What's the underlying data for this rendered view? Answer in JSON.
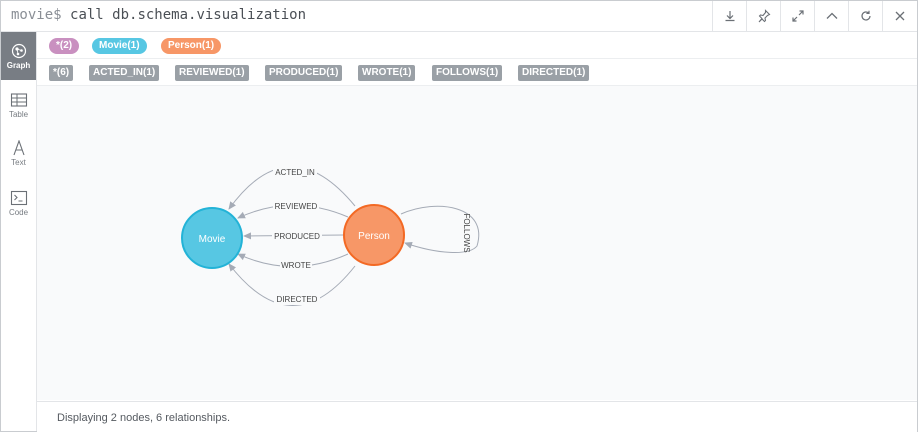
{
  "command": {
    "prompt": "movie$",
    "query": "call db.schema.visualization"
  },
  "toolbar": {
    "buttons": [
      {
        "name": "download-icon"
      },
      {
        "name": "pin-icon"
      },
      {
        "name": "expand-icon"
      },
      {
        "name": "collapse-up-icon"
      },
      {
        "name": "rerun-icon"
      },
      {
        "name": "close-icon"
      }
    ]
  },
  "sidebar": {
    "items": [
      {
        "label": "Graph",
        "icon": "graph-icon",
        "active": true
      },
      {
        "label": "Table",
        "icon": "table-icon",
        "active": false
      },
      {
        "label": "Text",
        "icon": "text-icon",
        "active": false
      },
      {
        "label": "Code",
        "icon": "code-icon",
        "active": false
      }
    ]
  },
  "node_labels": [
    {
      "label": "*(2)",
      "color": "#c990c0"
    },
    {
      "label": "Movie(1)",
      "color": "#57c7e3"
    },
    {
      "label": "Person(1)",
      "color": "#f79767"
    }
  ],
  "relationship_types": [
    {
      "label": "*(6)"
    },
    {
      "label": "ACTED_IN(1)"
    },
    {
      "label": "REVIEWED(1)"
    },
    {
      "label": "PRODUCED(1)"
    },
    {
      "label": "WROTE(1)"
    },
    {
      "label": "FOLLOWS(1)"
    },
    {
      "label": "DIRECTED(1)"
    }
  ],
  "graph": {
    "nodes": [
      {
        "id": "movie",
        "caption": "Movie",
        "fill": "#57c7e3",
        "stroke": "#23b3d7"
      },
      {
        "id": "person",
        "caption": "Person",
        "fill": "#f79767",
        "stroke": "#f36924"
      }
    ],
    "relationships": [
      {
        "type": "ACTED_IN"
      },
      {
        "type": "REVIEWED"
      },
      {
        "type": "PRODUCED"
      },
      {
        "type": "WROTE"
      },
      {
        "type": "DIRECTED"
      },
      {
        "type": "FOLLOWS"
      }
    ]
  },
  "status": {
    "text": "Displaying 2 nodes, 6 relationships."
  }
}
